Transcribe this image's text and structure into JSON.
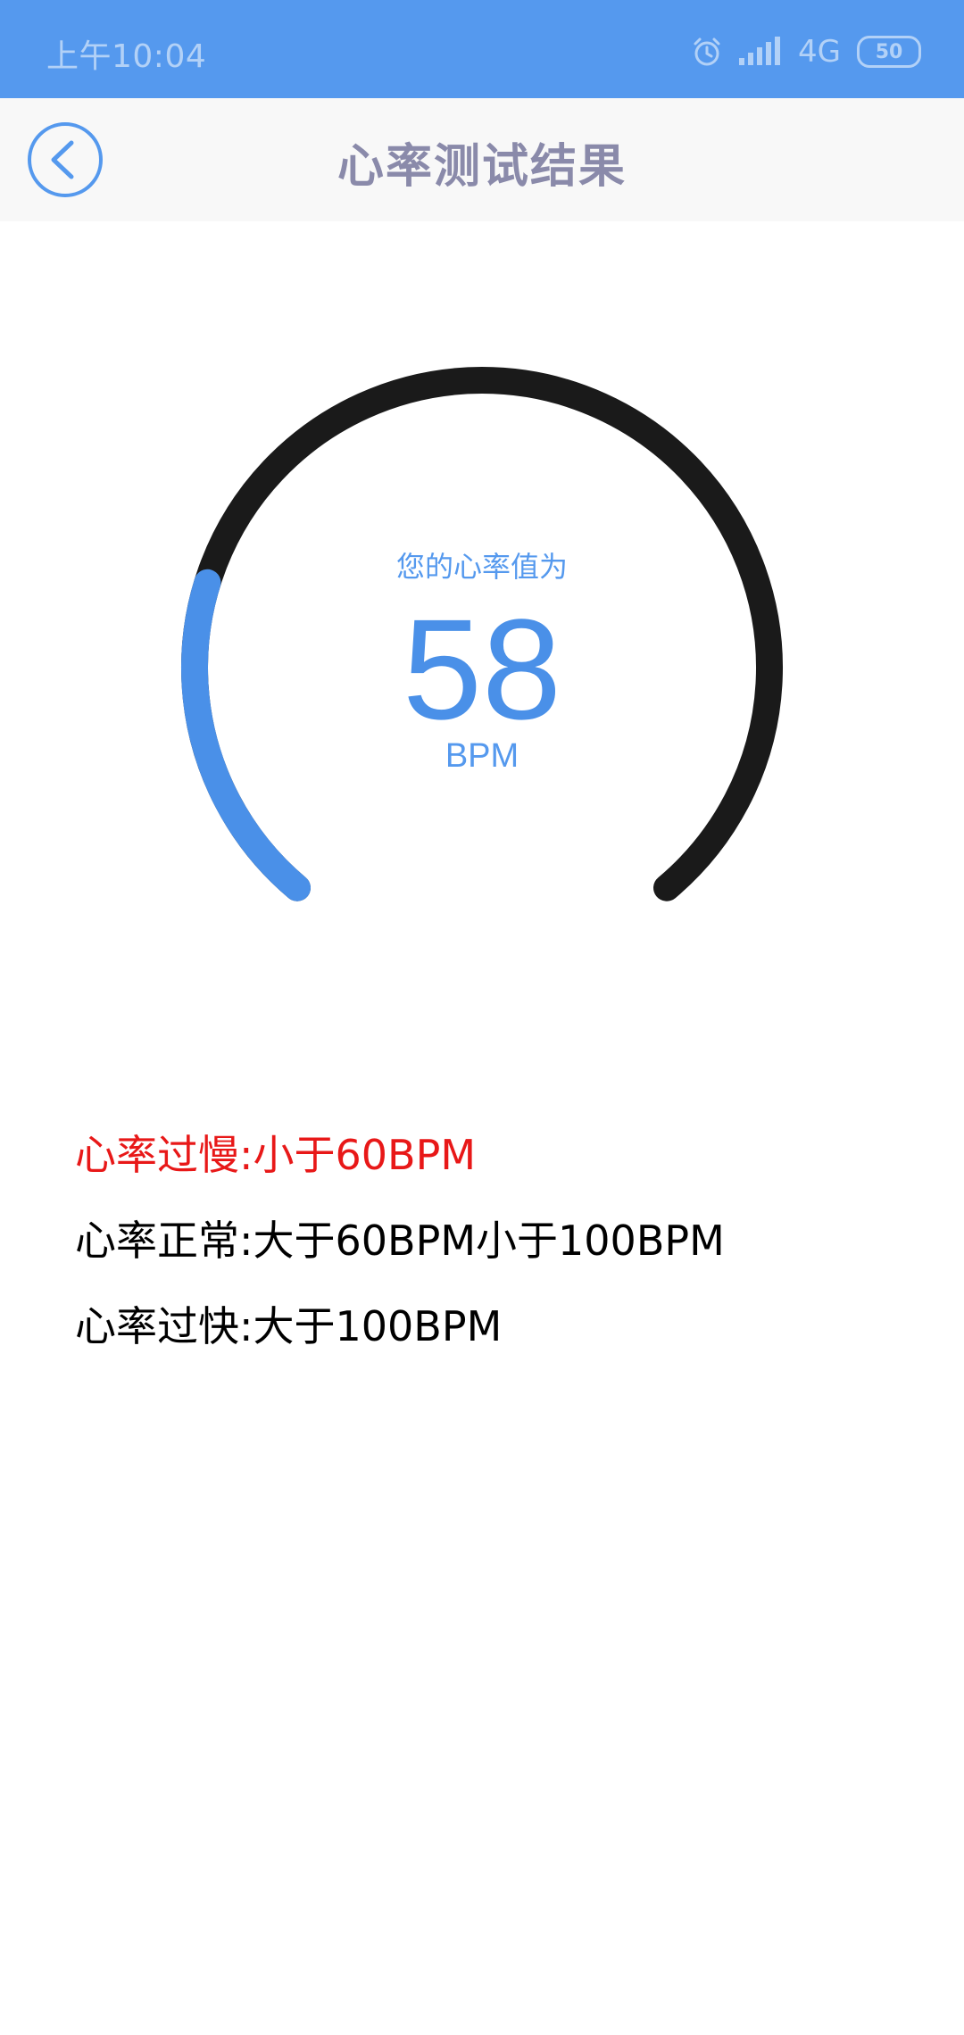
{
  "status_bar": {
    "time": "上午10:04",
    "network": "4G",
    "battery": "50",
    "icons": [
      "alarm-icon",
      "signal-icon",
      "battery-icon"
    ]
  },
  "header": {
    "title": "心率测试结果",
    "back_icon": "chevron-left-icon"
  },
  "gauge": {
    "caption": "您的心率值为",
    "value": "58",
    "unit": "BPM",
    "fill_fraction": 0.24,
    "fill_color": "#4a90e8",
    "track_color": "#1a1a1a"
  },
  "legend": {
    "slow": "心率过慢:小于60BPM",
    "normal": "心率正常:大于60BPM小于100BPM",
    "fast": "心率过快:大于100BPM"
  },
  "colors": {
    "accent": "#5599ee",
    "slow_text": "#e81818",
    "header_bg": "#f8f8f8",
    "title_text": "#8a8aaa"
  }
}
